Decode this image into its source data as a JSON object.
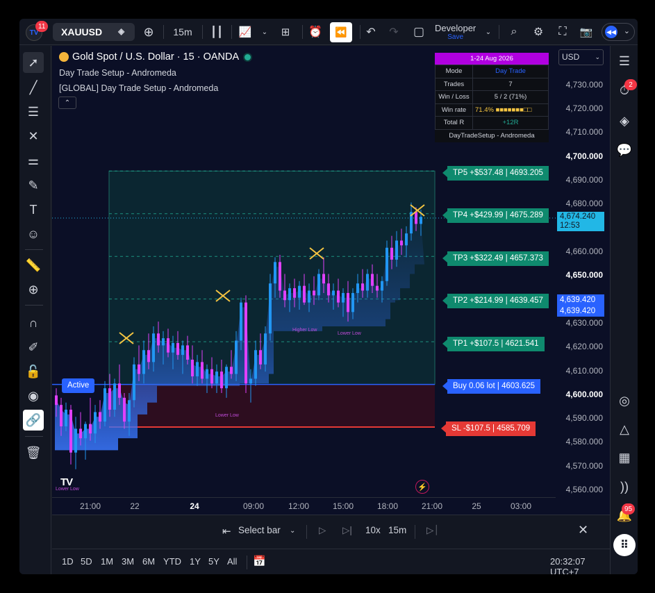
{
  "toolbar": {
    "avatar_badge": "11",
    "symbol": "XAUUSD",
    "interval": "15m",
    "layout_name": "Developer",
    "layout_status": "Save"
  },
  "legend": {
    "title": "Gold Spot / U.S. Dollar · 15 · OANDA",
    "indicator1": "Day Trade Setup - Andromeda",
    "indicator2": "[GLOBAL] Day Trade Setup - Andromeda"
  },
  "stats_table": {
    "header": "1-24 Aug 2026",
    "rows": [
      {
        "k": "Mode",
        "v": "Day Trade"
      },
      {
        "k": "Trades",
        "v": "7"
      },
      {
        "k": "Win / Loss",
        "v": "5 / 2  (71%)"
      },
      {
        "k": "Win rate",
        "v": "71.4%"
      },
      {
        "k": "Total R",
        "v": "+12R"
      }
    ],
    "footer": "DayTradeSetup - Andromeda"
  },
  "currency": "USD",
  "price_axis": [
    {
      "v": "4,730.000",
      "bold": false
    },
    {
      "v": "4,720.000",
      "bold": false
    },
    {
      "v": "4,710.000",
      "bold": false
    },
    {
      "v": "4,700.000",
      "bold": true
    },
    {
      "v": "4,690.000",
      "bold": false
    },
    {
      "v": "4,680.000",
      "bold": false
    },
    {
      "v": "4,660.000",
      "bold": false
    },
    {
      "v": "4,650.000",
      "bold": true
    },
    {
      "v": "4,630.000",
      "bold": false
    },
    {
      "v": "4,620.000",
      "bold": false
    },
    {
      "v": "4,610.000",
      "bold": false
    },
    {
      "v": "4,600.000",
      "bold": true
    },
    {
      "v": "4,590.000",
      "bold": false
    },
    {
      "v": "4,580.000",
      "bold": false
    },
    {
      "v": "4,570.000",
      "bold": false
    },
    {
      "v": "4,560.000",
      "bold": false
    }
  ],
  "current_price": {
    "price": "4,674.240",
    "countdown": "12:53"
  },
  "blue_tags": [
    "4,639.420",
    "4,639.420"
  ],
  "trade_labels": {
    "tp5": "TP5 +$537.48 | 4693.205",
    "tp4": "TP4 +$429.99 | 4675.289",
    "tp3": "TP3 +$322.49 | 4657.373",
    "tp2": "TP2 +$214.99 | 4639.457",
    "tp1": "TP1 +$107.5 | 4621.541",
    "entry": "Buy 0.06 lot | 4603.625",
    "sl": "SL -$107.5 | 4585.709",
    "active": "Active"
  },
  "annotations": {
    "lower_low_1": "Lower Low",
    "lower_low_2": "Lower Low",
    "higher_low": "Higher Low",
    "lower_low_3": "Lower Low"
  },
  "time_axis": [
    {
      "t": "21:00",
      "bold": false
    },
    {
      "t": "22",
      "bold": false
    },
    {
      "t": "24",
      "bold": true
    },
    {
      "t": "09:00",
      "bold": false
    },
    {
      "t": "12:00",
      "bold": false
    },
    {
      "t": "15:00",
      "bold": false
    },
    {
      "t": "18:00",
      "bold": false
    },
    {
      "t": "21:00",
      "bold": false
    },
    {
      "t": "25",
      "bold": false
    },
    {
      "t": "03:00",
      "bold": false
    }
  ],
  "replay": {
    "select_bar": "Select bar",
    "speed": "10x",
    "interval": "15m"
  },
  "bottom": {
    "ranges": [
      "1D",
      "5D",
      "1M",
      "3M",
      "6M",
      "YTD",
      "1Y",
      "5Y",
      "All"
    ],
    "clock": "20:32:07 UTC+7"
  },
  "right_badges": {
    "alerts": "2",
    "notifications": "95"
  },
  "colors": {
    "chart_bg": "#0b0f26",
    "bull_candle": "#2196f3",
    "bear_candle": "#e040fb",
    "tp_green": "#0f8a6e",
    "entry_blue": "#2962ff",
    "sl_red": "#e53935",
    "price_cyan": "#22b7e6",
    "stats_header": "#b000e0"
  },
  "chart_data": {
    "type": "candlestick",
    "symbol": "Gold Spot / U.S. Dollar · 15 · OANDA",
    "ylim": [
      4555,
      4738
    ],
    "levels": {
      "tp5": 4693.205,
      "tp4": 4675.289,
      "tp3": 4657.373,
      "tp2": 4639.457,
      "tp1": 4621.541,
      "entry": 4603.625,
      "sl": 4585.709
    },
    "candles": [
      [
        4599,
        4602,
        4590,
        4595
      ],
      [
        4595,
        4598,
        4582,
        4586
      ],
      [
        4586,
        4596,
        4584,
        4593
      ],
      [
        4593,
        4595,
        4570,
        4575
      ],
      [
        4575,
        4590,
        4568,
        4585
      ],
      [
        4585,
        4592,
        4578,
        4581
      ],
      [
        4581,
        4588,
        4572,
        4587
      ],
      [
        4587,
        4598,
        4580,
        4583
      ],
      [
        4583,
        4595,
        4579,
        4592
      ],
      [
        4592,
        4597,
        4585,
        4588
      ],
      [
        4588,
        4605,
        4586,
        4602
      ],
      [
        4602,
        4608,
        4590,
        4593
      ],
      [
        4593,
        4606,
        4590,
        4604
      ],
      [
        4604,
        4612,
        4595,
        4598
      ],
      [
        4598,
        4600,
        4585,
        4588
      ],
      [
        4588,
        4600,
        4582,
        4597
      ],
      [
        4597,
        4615,
        4594,
        4612
      ],
      [
        4612,
        4620,
        4605,
        4608
      ],
      [
        4608,
        4622,
        4604,
        4618
      ],
      [
        4618,
        4625,
        4610,
        4613
      ],
      [
        4613,
        4628,
        4609,
        4625
      ],
      [
        4625,
        4630,
        4617,
        4620
      ],
      [
        4620,
        4626,
        4612,
        4623
      ],
      [
        4623,
        4627,
        4615,
        4617
      ],
      [
        4617,
        4624,
        4610,
        4621
      ],
      [
        4621,
        4626,
        4614,
        4616
      ],
      [
        4616,
        4622,
        4608,
        4620
      ],
      [
        4620,
        4624,
        4612,
        4614
      ],
      [
        4614,
        4620,
        4604,
        4607
      ],
      [
        4607,
        4616,
        4603,
        4613
      ],
      [
        4613,
        4618,
        4604,
        4606
      ],
      [
        4606,
        4612,
        4600,
        4610
      ],
      [
        4610,
        4615,
        4602,
        4604
      ],
      [
        4604,
        4612,
        4600,
        4609
      ],
      [
        4609,
        4614,
        4600,
        4602
      ],
      [
        4602,
        4612,
        4598,
        4611
      ],
      [
        4611,
        4618,
        4606,
        4608
      ],
      [
        4608,
        4626,
        4605,
        4622
      ],
      [
        4622,
        4640,
        4618,
        4638
      ],
      [
        4638,
        4641,
        4600,
        4604
      ],
      [
        4604,
        4610,
        4596,
        4606
      ],
      [
        4606,
        4622,
        4603,
        4618
      ],
      [
        4618,
        4625,
        4610,
        4612
      ],
      [
        4612,
        4628,
        4609,
        4625
      ],
      [
        4625,
        4650,
        4622,
        4646
      ],
      [
        4646,
        4657,
        4640,
        4655
      ],
      [
        4655,
        4658,
        4640,
        4643
      ],
      [
        4643,
        4650,
        4636,
        4639
      ],
      [
        4639,
        4646,
        4634,
        4644
      ],
      [
        4644,
        4648,
        4636,
        4640
      ],
      [
        4640,
        4647,
        4635,
        4645
      ],
      [
        4645,
        4650,
        4637,
        4638
      ],
      [
        4638,
        4646,
        4634,
        4643
      ],
      [
        4643,
        4649,
        4637,
        4641
      ],
      [
        4641,
        4652,
        4639,
        4650
      ],
      [
        4650,
        4657,
        4642,
        4646
      ],
      [
        4646,
        4650,
        4638,
        4641
      ],
      [
        4641,
        4646,
        4635,
        4643
      ],
      [
        4643,
        4648,
        4636,
        4638
      ],
      [
        4638,
        4644,
        4632,
        4642
      ],
      [
        4642,
        4647,
        4630,
        4634
      ],
      [
        4634,
        4644,
        4631,
        4642
      ],
      [
        4642,
        4650,
        4638,
        4646
      ],
      [
        4646,
        4652,
        4640,
        4643
      ],
      [
        4643,
        4652,
        4640,
        4650
      ],
      [
        4650,
        4654,
        4642,
        4645
      ],
      [
        4645,
        4650,
        4640,
        4643
      ],
      [
        4643,
        4649,
        4638,
        4647
      ],
      [
        4647,
        4664,
        4645,
        4661
      ],
      [
        4661,
        4666,
        4652,
        4656
      ],
      [
        4656,
        4668,
        4653,
        4664
      ],
      [
        4664,
        4669,
        4658,
        4662
      ],
      [
        4662,
        4670,
        4657,
        4667
      ],
      [
        4667,
        4680,
        4664,
        4676
      ],
      [
        4676,
        4678,
        4668,
        4671
      ],
      [
        4671,
        4677,
        4666,
        4674
      ]
    ]
  }
}
